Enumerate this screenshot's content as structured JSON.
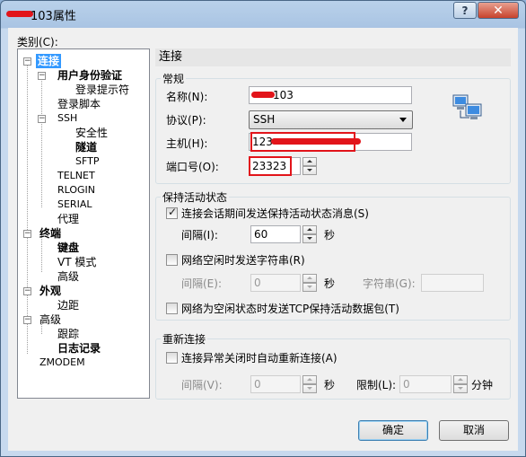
{
  "window": {
    "title": "103属性",
    "help_label": "?",
    "close_label": "✕"
  },
  "category_label": "类别(C):",
  "tree": {
    "connection": "连接",
    "user_auth": "用户身份验证",
    "login_prompts": "登录提示符",
    "login_script": "登录脚本",
    "ssh": "SSH",
    "security": "安全性",
    "tunneling": "隧道",
    "sftp": "SFTP",
    "telnet": "TELNET",
    "rlogin": "RLOGIN",
    "serial": "SERIAL",
    "proxy": "代理",
    "terminal": "终端",
    "keyboard": "键盘",
    "vt_mode": "VT 模式",
    "advanced_term": "高级",
    "appearance": "外观",
    "margin": "边距",
    "advanced": "高级",
    "trace": "跟踪",
    "logging": "日志记录",
    "zmodem": "ZMODEM"
  },
  "panel_title": "连接",
  "general": {
    "group_title": "常规",
    "name_label": "名称(N):",
    "name_value": "103",
    "protocol_label": "协议(P):",
    "protocol_value": "SSH",
    "host_label": "主机(H):",
    "host_value": "123",
    "port_label": "端口号(O):",
    "port_value": "23323"
  },
  "keepalive": {
    "group_title": "保持活动状态",
    "send_keepalive_label": "连接会话期间发送保持活动状态消息(S)",
    "send_keepalive_checked": true,
    "interval_label": "间隔(I):",
    "interval_value": "60",
    "seconds_unit": "秒",
    "idle_string_label": "网络空闲时发送字符串(R)",
    "idle_string_checked": false,
    "idle_interval_label": "间隔(E):",
    "idle_interval_value": "0",
    "idle_seconds_unit": "秒",
    "string_label": "字符串(G):",
    "string_value": "",
    "tcp_keepalive_label": "网络为空闲状态时发送TCP保持活动数据包(T)",
    "tcp_keepalive_checked": false
  },
  "reconnect": {
    "group_title": "重新连接",
    "auto_reconnect_label": "连接异常关闭时自动重新连接(A)",
    "auto_reconnect_checked": false,
    "interval_label": "间隔(V):",
    "interval_value": "0",
    "seconds_unit": "秒",
    "limit_label": "限制(L):",
    "limit_value": "0",
    "minutes_unit": "分钟"
  },
  "buttons": {
    "ok": "确定",
    "cancel": "取消"
  },
  "icons": {
    "network": "network-computers-icon"
  }
}
